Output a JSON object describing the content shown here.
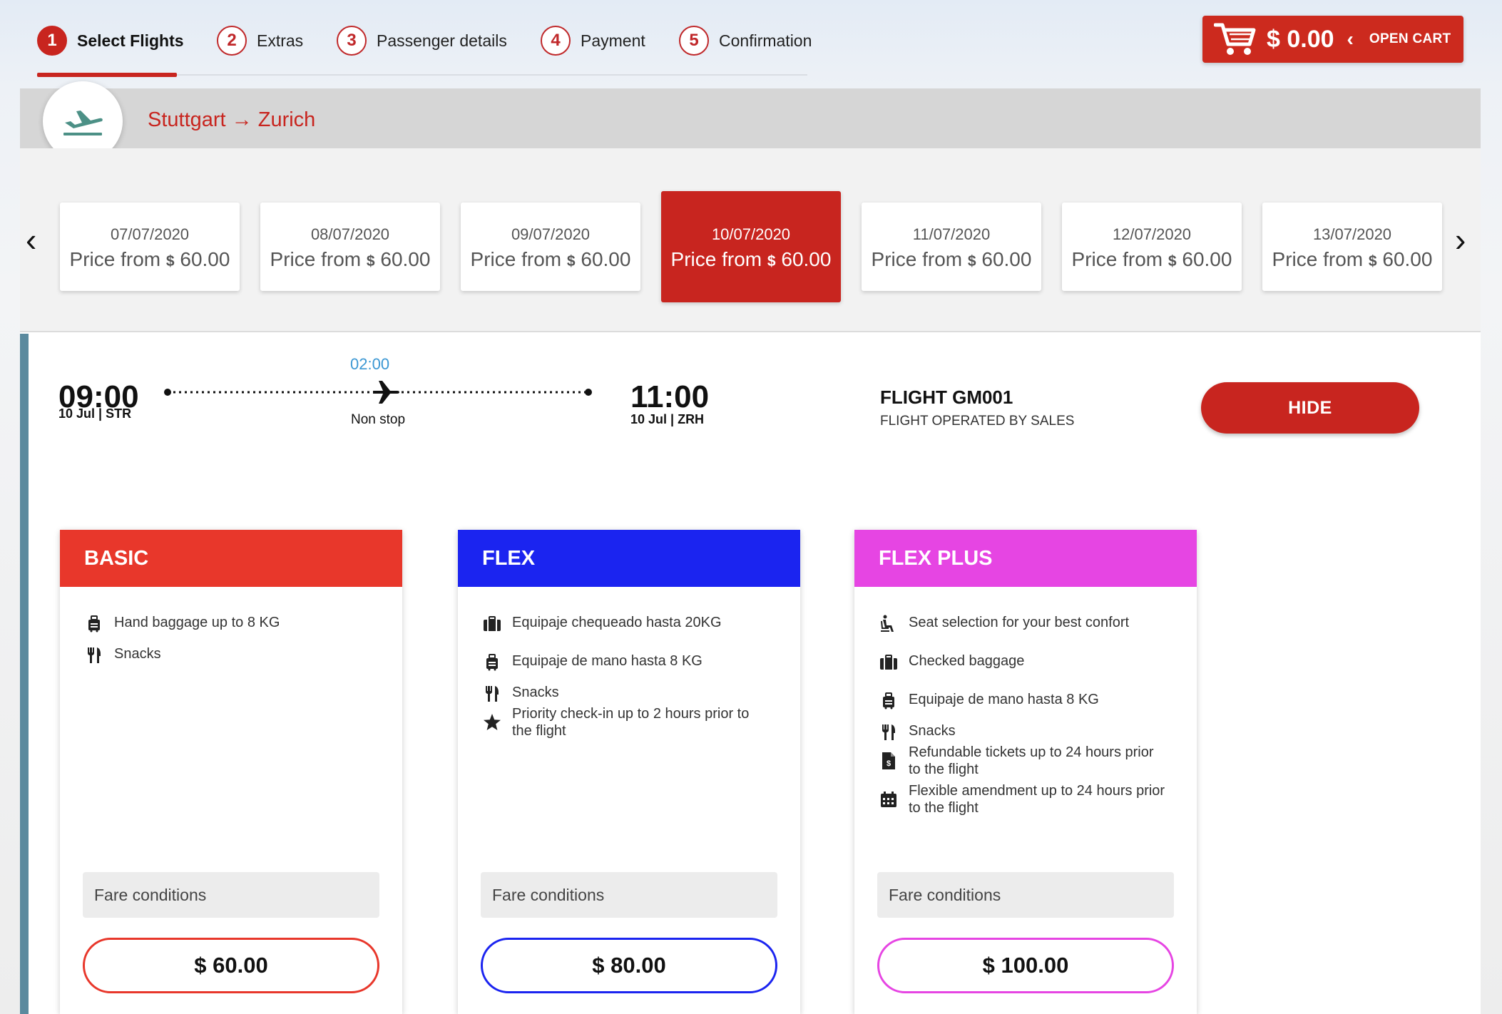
{
  "stepper": [
    {
      "num": "1",
      "label": "Select Flights"
    },
    {
      "num": "2",
      "label": "Extras"
    },
    {
      "num": "3",
      "label": "Passenger details"
    },
    {
      "num": "4",
      "label": "Payment"
    },
    {
      "num": "5",
      "label": "Confirmation"
    }
  ],
  "cart": {
    "amount": "$ 0.00",
    "chevron": "‹",
    "label": "OPEN CART",
    "icon": "shopping-cart-icon"
  },
  "route": {
    "text": "Stuttgart → Zurich",
    "icon": "departure-plane-icon"
  },
  "dates": [
    {
      "date": "07/07/2020",
      "price_prefix": "Price from",
      "currency": "$",
      "price": "60.00"
    },
    {
      "date": "08/07/2020",
      "price_prefix": "Price from",
      "currency": "$",
      "price": "60.00"
    },
    {
      "date": "09/07/2020",
      "price_prefix": "Price from",
      "currency": "$",
      "price": "60.00"
    },
    {
      "date": "10/07/2020",
      "price_prefix": "Price from",
      "currency": "$",
      "price": "60.00"
    },
    {
      "date": "11/07/2020",
      "price_prefix": "Price from",
      "currency": "$",
      "price": "60.00"
    },
    {
      "date": "12/07/2020",
      "price_prefix": "Price from",
      "currency": "$",
      "price": "60.00"
    },
    {
      "date": "13/07/2020",
      "price_prefix": "Price from",
      "currency": "$",
      "price": "60.00"
    }
  ],
  "date_nav": {
    "prev": "‹",
    "next": "›"
  },
  "flight": {
    "departure_time": "09:00",
    "departure_info": "10 Jul | STR",
    "duration": "02:00",
    "stops": "Non stop",
    "arrival_time": "11:00",
    "arrival_info": "10 Jul | ZRH",
    "number": "FLIGHT GM001",
    "operated_by": "FLIGHT OPERATED BY SALES",
    "hide_label": "HIDE"
  },
  "fares": [
    {
      "name": "BASIC",
      "color": "#e8372b",
      "features": [
        {
          "icon": "hand-baggage-icon",
          "text": "Hand baggage up to 8 KG"
        },
        {
          "icon": "utensils-icon",
          "text": "Snacks"
        }
      ],
      "conditions_label": "Fare conditions",
      "price": "$ 60.00"
    },
    {
      "name": "FLEX",
      "color": "#1b24f0",
      "features": [
        {
          "icon": "suitcase-icon",
          "text": "Equipaje chequeado hasta 20KG"
        },
        {
          "icon": "hand-baggage-icon",
          "text": "Equipaje de mano hasta 8 KG"
        },
        {
          "icon": "utensils-icon",
          "text": "Snacks"
        },
        {
          "icon": "star-icon",
          "text": "Priority check-in up to 2 hours prior to the flight"
        }
      ],
      "conditions_label": "Fare conditions",
      "price": "$ 80.00"
    },
    {
      "name": "FLEX PLUS",
      "color": "#e645e3",
      "features": [
        {
          "icon": "seat-icon",
          "text": "Seat selection for your best confort"
        },
        {
          "icon": "suitcase-icon",
          "text": "Checked baggage"
        },
        {
          "icon": "hand-baggage-icon",
          "text": "Equipaje de mano hasta 8 KG"
        },
        {
          "icon": "utensils-icon",
          "text": "Snacks"
        },
        {
          "icon": "refund-document-icon",
          "text": "Refundable tickets up to 24 hours prior to the flight"
        },
        {
          "icon": "calendar-icon",
          "text": "Flexible amendment up to 24 hours prior to the flight"
        }
      ],
      "conditions_label": "Fare conditions",
      "price": "$ 100.00"
    }
  ]
}
